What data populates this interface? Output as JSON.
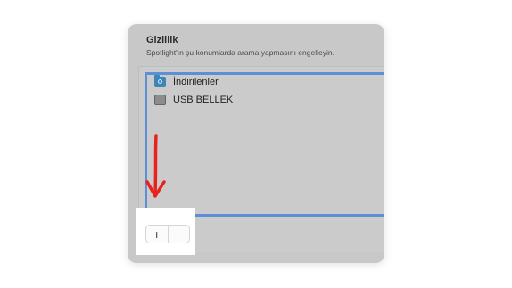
{
  "panel": {
    "title": "Gizlilik",
    "subtitle": "Spotlight'ın şu konumlarda arama yapmasını engelleyin."
  },
  "list": {
    "items": [
      {
        "label": "İndirilenler",
        "icon": "downloads-folder-icon"
      },
      {
        "label": "USB BELLEK",
        "icon": "usb-drive-icon"
      }
    ]
  },
  "buttons": {
    "add": "+",
    "remove": "−"
  },
  "colors": {
    "highlight": "#5b8fd6",
    "annotation_arrow": "#e8231f",
    "folder": "#3c86b8"
  }
}
